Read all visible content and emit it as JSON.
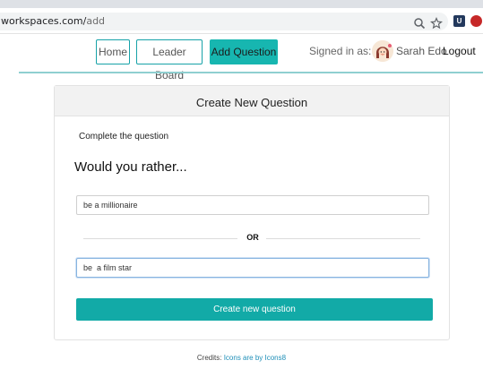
{
  "browser": {
    "url_host": "workspaces.com/",
    "url_path": "add"
  },
  "nav": {
    "home": "Home",
    "leader_board": "Leader Board",
    "add_question": "Add Question",
    "signed_in_label": "Signed in as:",
    "username": "Sarah Edo",
    "logout": "Logout"
  },
  "card": {
    "title": "Create New Question",
    "subtitle": "Complete the question",
    "heading": "Would you rather...",
    "option_one_value": "be a millionaire",
    "or_label": "OR",
    "option_two_value": "be  a film star",
    "submit_label": "Create new question"
  },
  "footer": {
    "credits_label": "Credits:",
    "credits_link": "Icons are by Icons8"
  },
  "colors": {
    "accent": "#17b6b0",
    "button": "#12aaa7"
  }
}
